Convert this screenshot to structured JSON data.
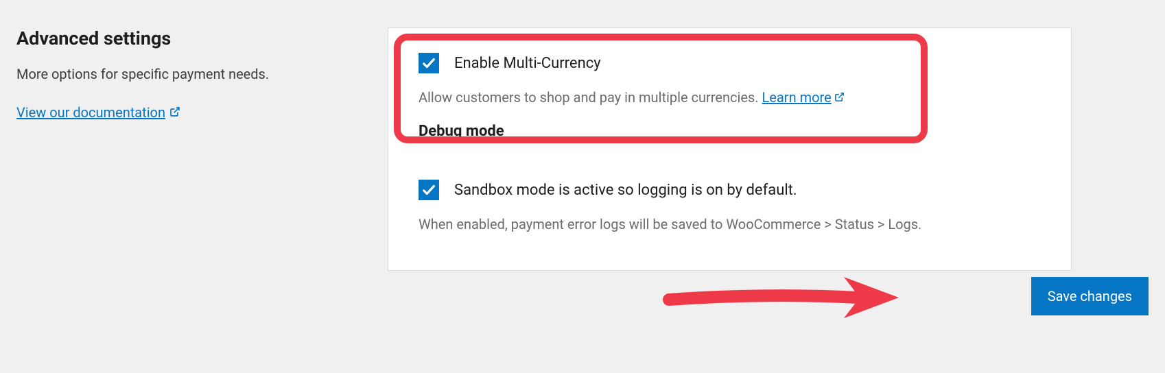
{
  "sidebar": {
    "title": "Advanced settings",
    "subtitle": "More options for specific payment needs.",
    "doc_link": "View our documentation"
  },
  "panel": {
    "multi_currency": {
      "label": "Enable Multi-Currency",
      "description": "Allow customers to shop and pay in multiple currencies.",
      "learn_more": "Learn more"
    },
    "debug_heading": "Debug mode",
    "sandbox": {
      "label": "Sandbox mode is active so logging is on by default.",
      "description": "When enabled, payment error logs will be saved to WooCommerce > Status > Logs."
    }
  },
  "save_button": "Save changes"
}
